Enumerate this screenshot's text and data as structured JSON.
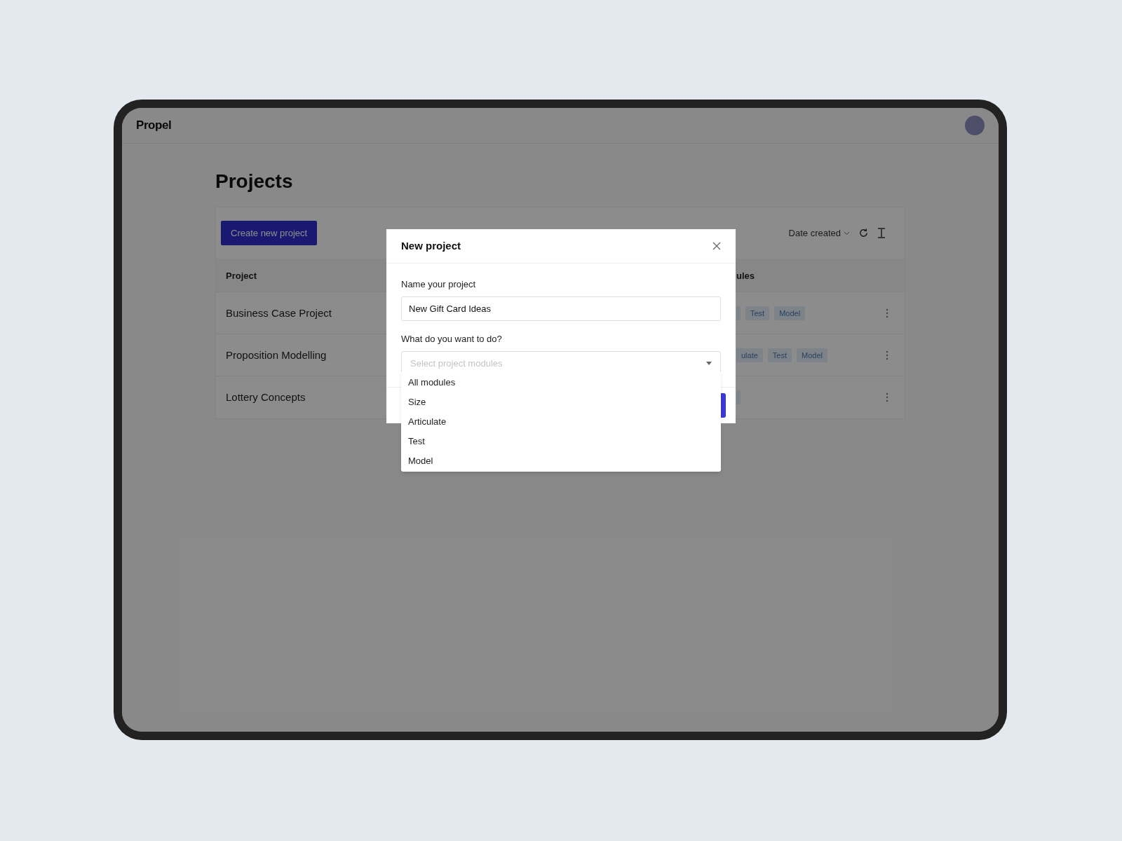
{
  "app": {
    "logo": "Propel"
  },
  "page_title": "Projects",
  "toolbar": {
    "create_button": "Create new project",
    "sort_label": "Date created"
  },
  "table": {
    "columns": [
      "Project",
      "ules"
    ],
    "rows": [
      {
        "project": "Business Case Project",
        "tags": [
          "Test",
          "Model"
        ]
      },
      {
        "project": "Proposition Modelling",
        "tags": [
          "ulate",
          "Test",
          "Model"
        ]
      },
      {
        "project": "Lottery Concepts"
      }
    ]
  },
  "dialog": {
    "title": "New project",
    "fields": [
      {
        "kind": "text",
        "label": "Name your project",
        "value": "New Gift Card Ideas"
      },
      {
        "kind": "select",
        "label": "What do you want to do?",
        "placeholder": "Select project modules",
        "expanded": true
      }
    ],
    "options": [
      "All modules",
      "Size",
      "Articulate",
      "Test",
      "Model"
    ]
  }
}
